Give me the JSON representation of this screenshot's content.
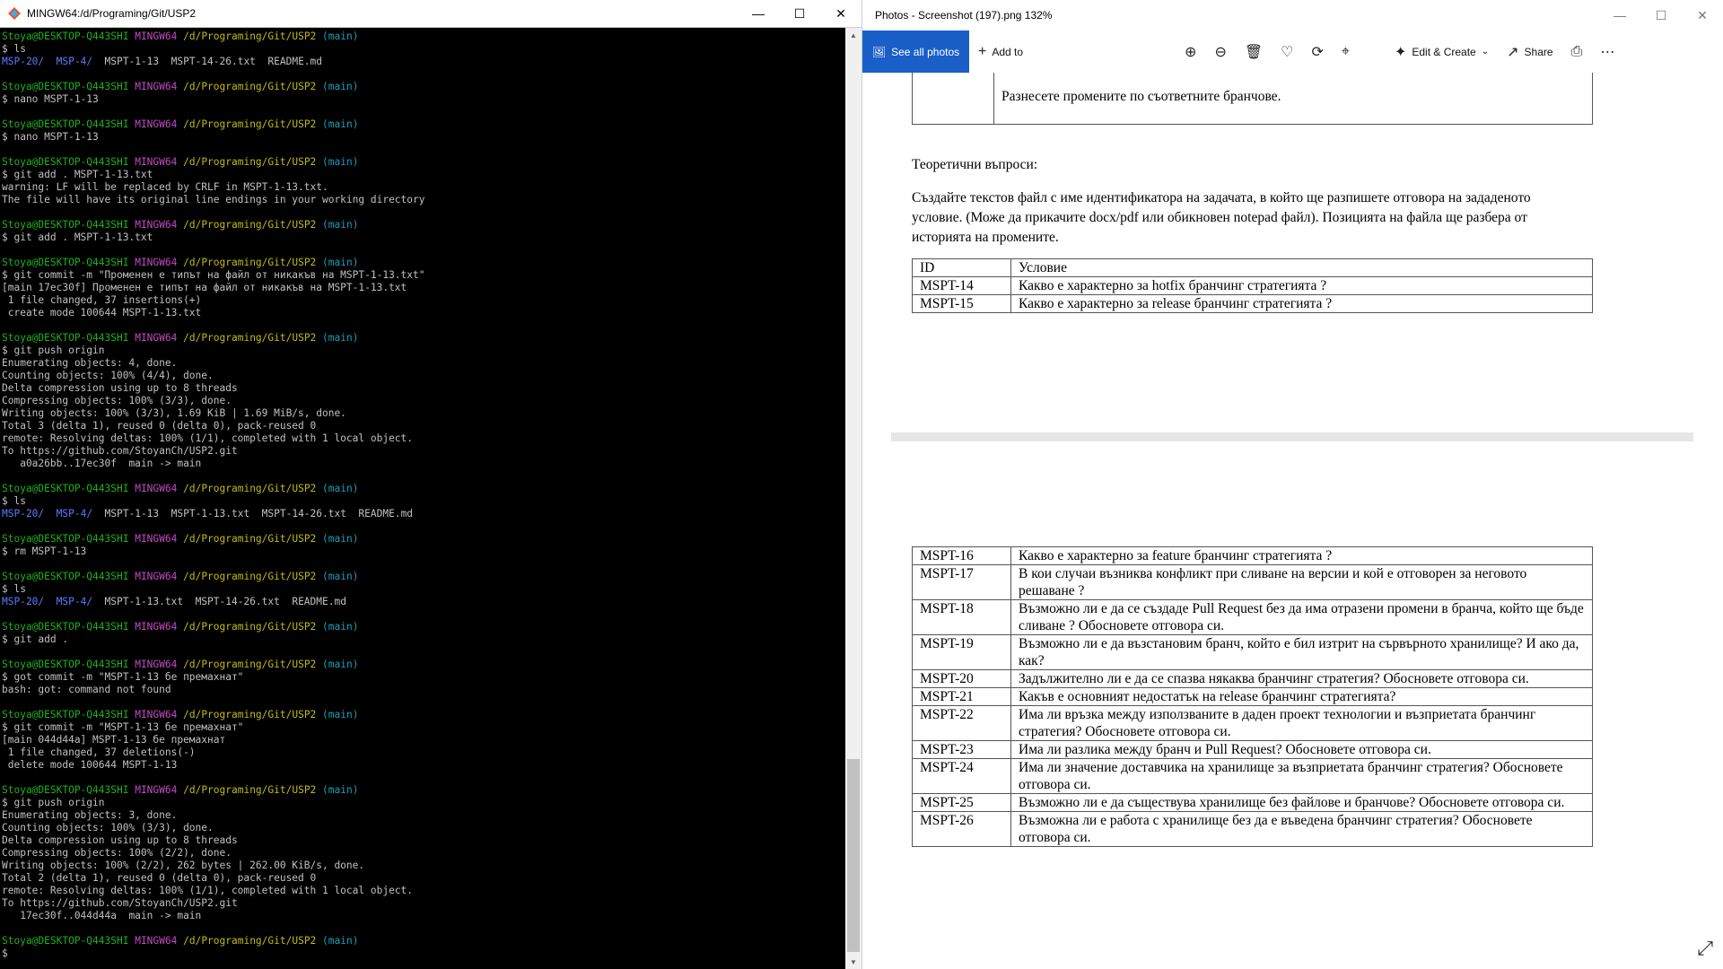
{
  "terminal": {
    "title": "MINGW64:/d/Programing/Git/USP2",
    "prompt": {
      "user": "Stoya@DESKTOP-Q443SHI",
      "env": "MINGW64",
      "path": "/d/Programing/Git/USP2",
      "branch": "(main)"
    },
    "lines": [
      {
        "t": "prompt"
      },
      {
        "t": "text",
        "s": "$ ls"
      },
      {
        "t": "ls",
        "dirs": [
          "MSP-20/",
          "MSP-4/"
        ],
        "rest": "  MSPT-1-13  MSPT-14-26.txt  README.md"
      },
      {
        "t": "blank"
      },
      {
        "t": "prompt"
      },
      {
        "t": "text",
        "s": "$ nano MSPT-1-13"
      },
      {
        "t": "blank"
      },
      {
        "t": "prompt"
      },
      {
        "t": "text",
        "s": "$ nano MSPT-1-13"
      },
      {
        "t": "blank"
      },
      {
        "t": "prompt"
      },
      {
        "t": "text",
        "s": "$ git add . MSPT-1-13.txt"
      },
      {
        "t": "text",
        "s": "warning: LF will be replaced by CRLF in MSPT-1-13.txt."
      },
      {
        "t": "text",
        "s": "The file will have its original line endings in your working directory"
      },
      {
        "t": "blank"
      },
      {
        "t": "prompt"
      },
      {
        "t": "text",
        "s": "$ git add . MSPT-1-13.txt"
      },
      {
        "t": "blank"
      },
      {
        "t": "prompt"
      },
      {
        "t": "text",
        "s": "$ git commit -m \"Променен е типът на файл от никакъв на MSPT-1-13.txt\""
      },
      {
        "t": "text",
        "s": "[main 17ec30f] Променен е типът на файл от никакъв на MSPT-1-13.txt"
      },
      {
        "t": "text",
        "s": " 1 file changed, 37 insertions(+)"
      },
      {
        "t": "text",
        "s": " create mode 100644 MSPT-1-13.txt"
      },
      {
        "t": "blank"
      },
      {
        "t": "prompt"
      },
      {
        "t": "text",
        "s": "$ git push origin"
      },
      {
        "t": "text",
        "s": "Enumerating objects: 4, done."
      },
      {
        "t": "text",
        "s": "Counting objects: 100% (4/4), done."
      },
      {
        "t": "text",
        "s": "Delta compression using up to 8 threads"
      },
      {
        "t": "text",
        "s": "Compressing objects: 100% (3/3), done."
      },
      {
        "t": "text",
        "s": "Writing objects: 100% (3/3), 1.69 KiB | 1.69 MiB/s, done."
      },
      {
        "t": "text",
        "s": "Total 3 (delta 1), reused 0 (delta 0), pack-reused 0"
      },
      {
        "t": "text",
        "s": "remote: Resolving deltas: 100% (1/1), completed with 1 local object."
      },
      {
        "t": "text",
        "s": "To https://github.com/StoyanCh/USP2.git"
      },
      {
        "t": "text",
        "s": "   a0a26bb..17ec30f  main -> main"
      },
      {
        "t": "blank"
      },
      {
        "t": "prompt"
      },
      {
        "t": "text",
        "s": "$ ls"
      },
      {
        "t": "ls",
        "dirs": [
          "MSP-20/",
          "MSP-4/"
        ],
        "rest": "  MSPT-1-13  MSPT-1-13.txt  MSPT-14-26.txt  README.md"
      },
      {
        "t": "blank"
      },
      {
        "t": "prompt"
      },
      {
        "t": "text",
        "s": "$ rm MSPT-1-13"
      },
      {
        "t": "blank"
      },
      {
        "t": "prompt"
      },
      {
        "t": "text",
        "s": "$ ls"
      },
      {
        "t": "ls",
        "dirs": [
          "MSP-20/",
          "MSP-4/"
        ],
        "rest": "  MSPT-1-13.txt  MSPT-14-26.txt  README.md"
      },
      {
        "t": "blank"
      },
      {
        "t": "prompt"
      },
      {
        "t": "text",
        "s": "$ git add ."
      },
      {
        "t": "blank"
      },
      {
        "t": "prompt"
      },
      {
        "t": "text",
        "s": "$ got commit -m \"MSPT-1-13 бе премахнат\""
      },
      {
        "t": "text",
        "s": "bash: got: command not found"
      },
      {
        "t": "blank"
      },
      {
        "t": "prompt"
      },
      {
        "t": "text",
        "s": "$ git commit -m \"MSPT-1-13 бе премахнат\""
      },
      {
        "t": "text",
        "s": "[main 044d44a] MSPT-1-13 бе премахнат"
      },
      {
        "t": "text",
        "s": " 1 file changed, 37 deletions(-)"
      },
      {
        "t": "text",
        "s": " delete mode 100644 MSPT-1-13"
      },
      {
        "t": "blank"
      },
      {
        "t": "prompt"
      },
      {
        "t": "text",
        "s": "$ git push origin"
      },
      {
        "t": "text",
        "s": "Enumerating objects: 3, done."
      },
      {
        "t": "text",
        "s": "Counting objects: 100% (3/3), done."
      },
      {
        "t": "text",
        "s": "Delta compression using up to 8 threads"
      },
      {
        "t": "text",
        "s": "Compressing objects: 100% (2/2), done."
      },
      {
        "t": "text",
        "s": "Writing objects: 100% (2/2), 262 bytes | 262.00 KiB/s, done."
      },
      {
        "t": "text",
        "s": "Total 2 (delta 1), reused 0 (delta 0), pack-reused 0"
      },
      {
        "t": "text",
        "s": "remote: Resolving deltas: 100% (1/1), completed with 1 local object."
      },
      {
        "t": "text",
        "s": "To https://github.com/StoyanCh/USP2.git"
      },
      {
        "t": "text",
        "s": "   17ec30f..044d44a  main -> main"
      },
      {
        "t": "blank"
      },
      {
        "t": "prompt"
      },
      {
        "t": "text",
        "s": "$"
      }
    ]
  },
  "photos": {
    "title": "Photos - Screenshot (197).png   132%",
    "toolbar": {
      "see_all": "See all photos",
      "add_to": "Add to",
      "edit_create": "Edit & Create",
      "share": "Share"
    },
    "doc": {
      "top_cell_text": "Разнесете промените по съответните бранчове.",
      "theory_heading": "Теоретични въпроси:",
      "instructions": "Създайте текстов файл с име идентификатора на задачата, в който ще разпишете отговора на зададеното условие. (Може да прикачите docx/pdf или обикновен notepad файл). Позицията на файла ще разбера от историята на промените.",
      "table1_header": {
        "id": "ID",
        "cond": "Условие"
      },
      "table1": [
        {
          "id": "MSPT-14",
          "cond": "Какво е характерно за hotfix бранчинг стратегията ?"
        },
        {
          "id": "MSPT-15",
          "cond": "Какво е характерно за release бранчинг стратегията ?"
        }
      ],
      "table2": [
        {
          "id": "MSPT-16",
          "cond": "Какво е характерно за feature бранчинг стратегията ?"
        },
        {
          "id": "MSPT-17",
          "cond": "В кои случаи възниква конфликт при сливане на версии и кой е отговорен за неговото решаване ?"
        },
        {
          "id": "MSPT-18",
          "cond": "Възможно ли е да се създаде Pull Request без да има отразени промени в бранча, който ще бъде сливане ? Обосновете отговора си."
        },
        {
          "id": "MSPT-19",
          "cond": "Възможно ли е да възстановим бранч, който е бил изтрит на сървърното хранилище? И ако да, как?"
        },
        {
          "id": "MSPT-20",
          "cond": "Задължително ли е да се спазва някаква бранчинг стратегия? Обосновете отговора си."
        },
        {
          "id": "MSPT-21",
          "cond": "Какъв е основният недостатък на release бранчинг стратегията?"
        },
        {
          "id": "MSPT-22",
          "cond": "Има ли връзка между използваните в даден проект технологии и възприетата бранчинг стратегия? Обосновете отговора си."
        },
        {
          "id": "MSPT-23",
          "cond": "Има ли разлика между бранч и Pull Request? Обосновете отговора си."
        },
        {
          "id": "MSPT-24",
          "cond": "Има ли значение доставчика на хранилище за възприетата бранчинг стратегия? Обосновете отговора си."
        },
        {
          "id": "MSPT-25",
          "cond": "Възможно ли е да съществува хранилище без файлове и бранчове? Обосновете отговора си."
        },
        {
          "id": "MSPT-26",
          "cond": "Възможна ли е работа с хранилище без да е въведена бранчинг стратегия? Обосновете отговора си."
        }
      ]
    }
  }
}
